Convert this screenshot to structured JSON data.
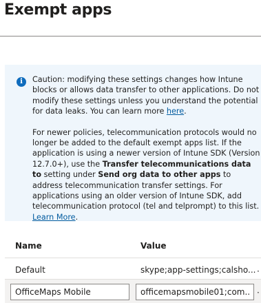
{
  "page": {
    "title": "Exempt apps"
  },
  "notice": {
    "p1_text": "Caution: modifying these settings changes how Intune blocks or allows data transfer to other applications. Do not modify these settings unless you understand the potential for data leaks. You can learn more ",
    "p1_link": "here",
    "p1_end": ".",
    "p2_a": "For newer policies, telecommunication protocols would no longer be added to the default exempt apps list. If the application is using a newer version of Intune SDK (Version 12.7.0+), use the ",
    "p2_bold1": "Transfer telecommunications data to",
    "p2_b": " setting under ",
    "p2_bold2": "Send org data to other apps",
    "p2_c": " to address telecommunication transfer settings. For applications using an older version of Intune SDK, add telecommunication protocol (tel and telprompt) to this list. ",
    "p2_link": "Learn More",
    "p2_end": "."
  },
  "table": {
    "headers": {
      "name": "Name",
      "value": "Value"
    },
    "rows": [
      {
        "name": "Default",
        "value": "skype;app-settings;calsho..."
      },
      {
        "name": "OfficeMaps Mobile",
        "value": "officemapsmobile01;com..."
      }
    ],
    "more_glyph": "·"
  }
}
